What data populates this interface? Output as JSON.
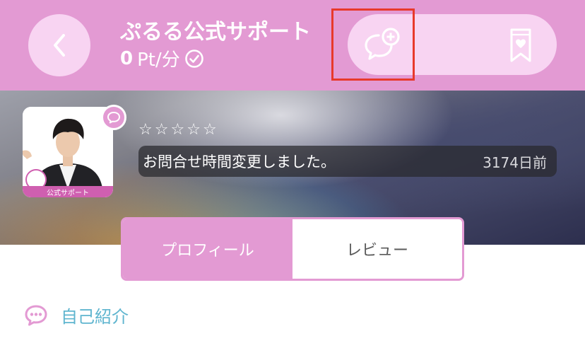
{
  "header": {
    "title": "ぷるる公式サポート",
    "rate_value": "0",
    "rate_unit": "Pt/分",
    "back_icon": "chevron-left-icon",
    "verified_icon": "check-circle-icon",
    "actions": {
      "chat_add_icon": "chat-plus-icon",
      "bookmark_icon": "bookmark-heart-icon"
    }
  },
  "profile": {
    "avatar_badge": "公式サポート",
    "rating_stars": 0,
    "rating_max": 5,
    "message": "お問合せ時間変更しました。",
    "message_time": "3174日前"
  },
  "tabs": [
    {
      "label": "プロフィール",
      "active": true
    },
    {
      "label": "レビュー",
      "active": false
    }
  ],
  "section": {
    "title": "自己紹介",
    "icon": "speech-bubble-icon"
  },
  "colors": {
    "primary": "#e39ad3",
    "light_pink": "#f8d4f2",
    "accent_blue": "#5fb5cf",
    "highlight_red": "#e8392b"
  }
}
